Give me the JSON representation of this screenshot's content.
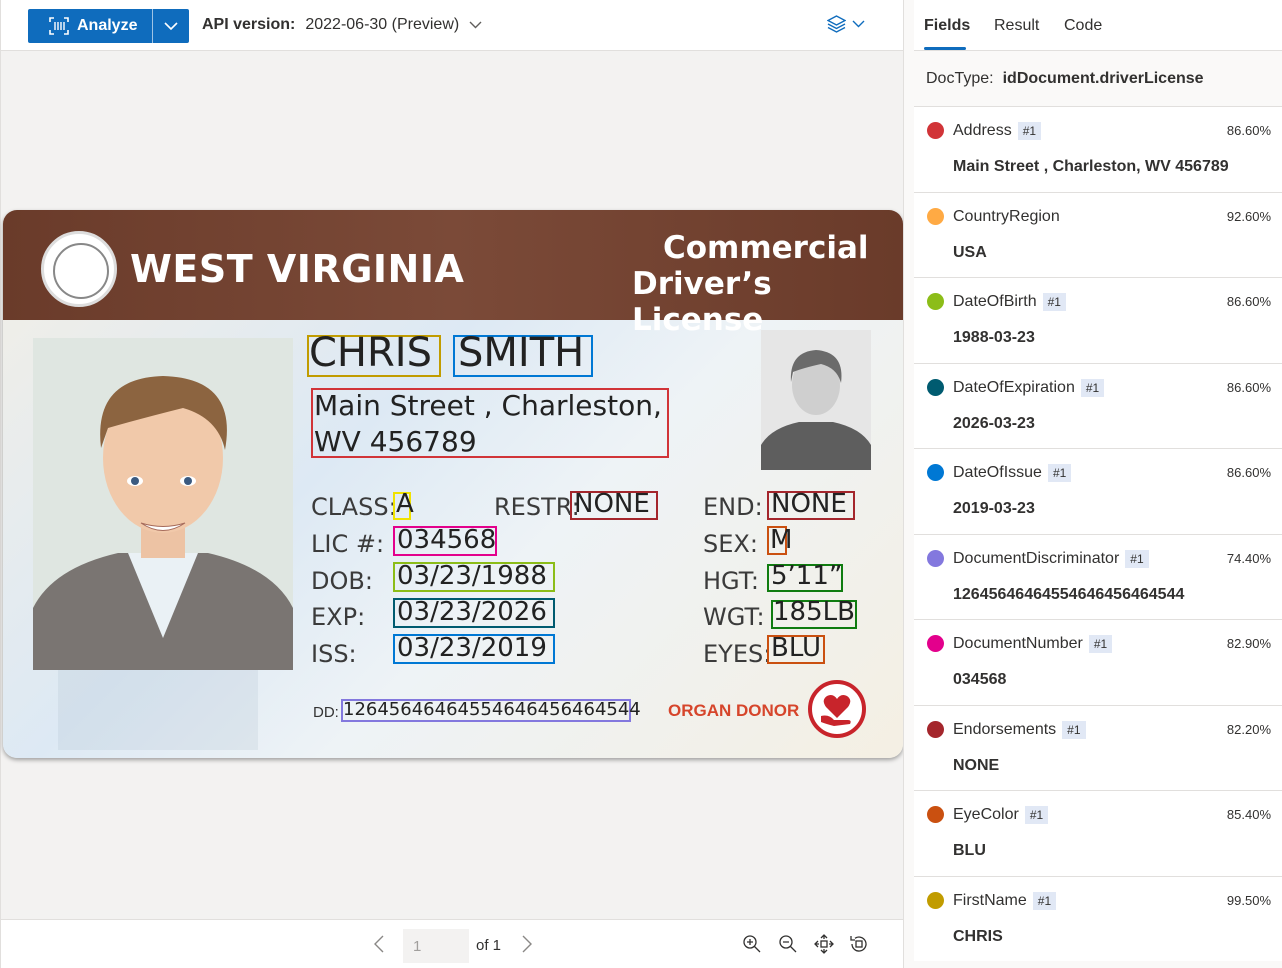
{
  "toolbar": {
    "analyze_label": "Analyze",
    "api_version_label": "API version:",
    "api_version_value": "2022-06-30 (Preview)"
  },
  "pager": {
    "page": "1",
    "of_label": "of 1"
  },
  "card": {
    "state": "WEST VIRGINIA",
    "title_line1": "Commercial",
    "title_line2": "Driver’s License",
    "first_name": "CHRIS",
    "last_name": "SMITH",
    "address_line1": "Main Street , Charleston,",
    "address_line2": "WV 456789",
    "class_label": "CLASS:",
    "class_value": "A",
    "restr_label": "RESTR:",
    "restr_value": "NONE",
    "end_label": "END:",
    "end_value": "NONE",
    "lic_label": "LIC #:",
    "lic_value": "034568",
    "sex_label": "SEX:",
    "sex_value": "M",
    "dob_label": "DOB:",
    "dob_value": "03/23/1988",
    "hgt_label": "HGT:",
    "hgt_value": "5’11”",
    "exp_label": "EXP:",
    "exp_value": "03/23/2026",
    "wgt_label": "WGT:",
    "wgt_value": "185LB",
    "iss_label": "ISS:",
    "iss_value": "03/23/2019",
    "eyes_label": "EYES:",
    "eyes_value": "BLU",
    "dd_label": "DD:",
    "dd_value": "12645646464554646456464544",
    "donor_label": "ORGAN DONOR"
  },
  "panel": {
    "tabs": [
      "Fields",
      "Result",
      "Code"
    ],
    "doctype_label": "DocType:",
    "doctype_value": "idDocument.driverLicense",
    "fields": [
      {
        "name": "Address",
        "badge": "#1",
        "confidence": "86.60%",
        "value": "Main Street , Charleston, WV 456789",
        "color": "#d13438"
      },
      {
        "name": "CountryRegion",
        "badge": "",
        "confidence": "92.60%",
        "value": "USA",
        "color": "#ffaa44"
      },
      {
        "name": "DateOfBirth",
        "badge": "#1",
        "confidence": "86.60%",
        "value": "1988-03-23",
        "color": "#8cbd18"
      },
      {
        "name": "DateOfExpiration",
        "badge": "#1",
        "confidence": "86.60%",
        "value": "2026-03-23",
        "color": "#005b70"
      },
      {
        "name": "DateOfIssue",
        "badge": "#1",
        "confidence": "86.60%",
        "value": "2019-03-23",
        "color": "#0078d4"
      },
      {
        "name": "DocumentDiscriminator",
        "badge": "#1",
        "confidence": "74.40%",
        "value": "12645646464554646456464544",
        "color": "#8378de"
      },
      {
        "name": "DocumentNumber",
        "badge": "#1",
        "confidence": "82.90%",
        "value": "034568",
        "color": "#e3008c"
      },
      {
        "name": "Endorsements",
        "badge": "#1",
        "confidence": "82.20%",
        "value": "NONE",
        "color": "#a4262c"
      },
      {
        "name": "EyeColor",
        "badge": "#1",
        "confidence": "85.40%",
        "value": "BLU",
        "color": "#ca5010"
      },
      {
        "name": "FirstName",
        "badge": "#1",
        "confidence": "99.50%",
        "value": "CHRIS",
        "color": "#c19c00"
      }
    ]
  }
}
